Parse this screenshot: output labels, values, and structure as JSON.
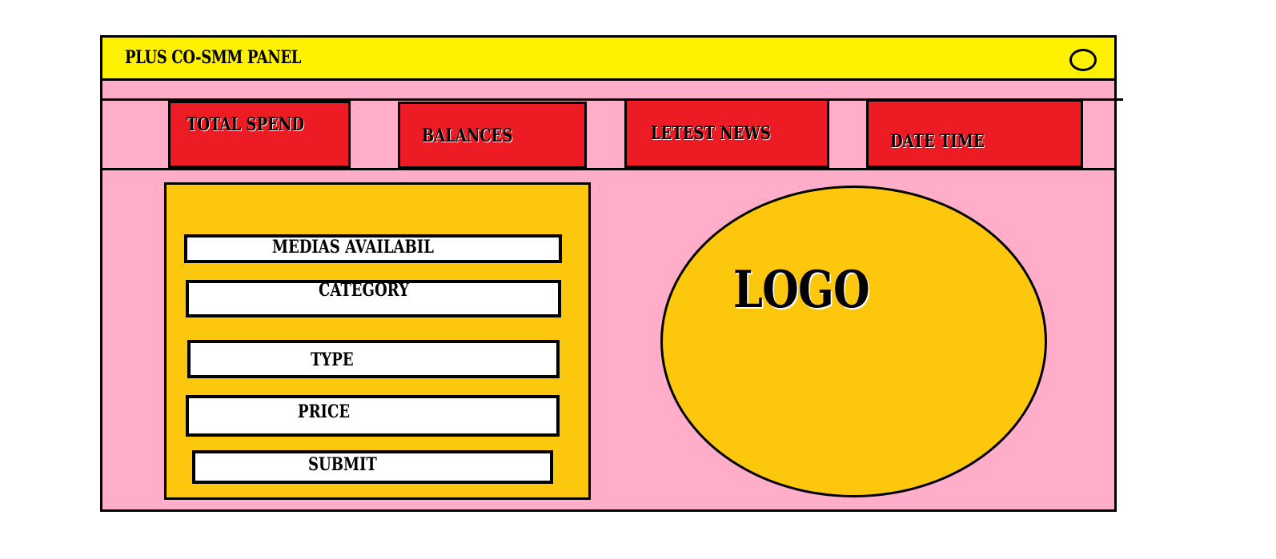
{
  "window": {
    "title": "PLUS CO-SMM PANEL",
    "title_bar_color": "#fff200",
    "close_icon": "circle-icon"
  },
  "stats": {
    "total_spend_label": "TOTAL SPEND",
    "balances_label": "BALANCES",
    "latest_news_label": "LETEST NEWS",
    "date_time_label": "DATE TIME",
    "box_color": "#ed1c24"
  },
  "form": {
    "medias_label": "MEDIAS AVAILABIL",
    "category_label": "CATEGORY",
    "type_label": "TYPE",
    "price_label": "PRICE",
    "submit_label": "SUBMIT",
    "panel_color": "#fcc70d"
  },
  "logo": {
    "text": "LOGO",
    "color": "#fcc70d"
  },
  "background_color": "#ffadc9"
}
